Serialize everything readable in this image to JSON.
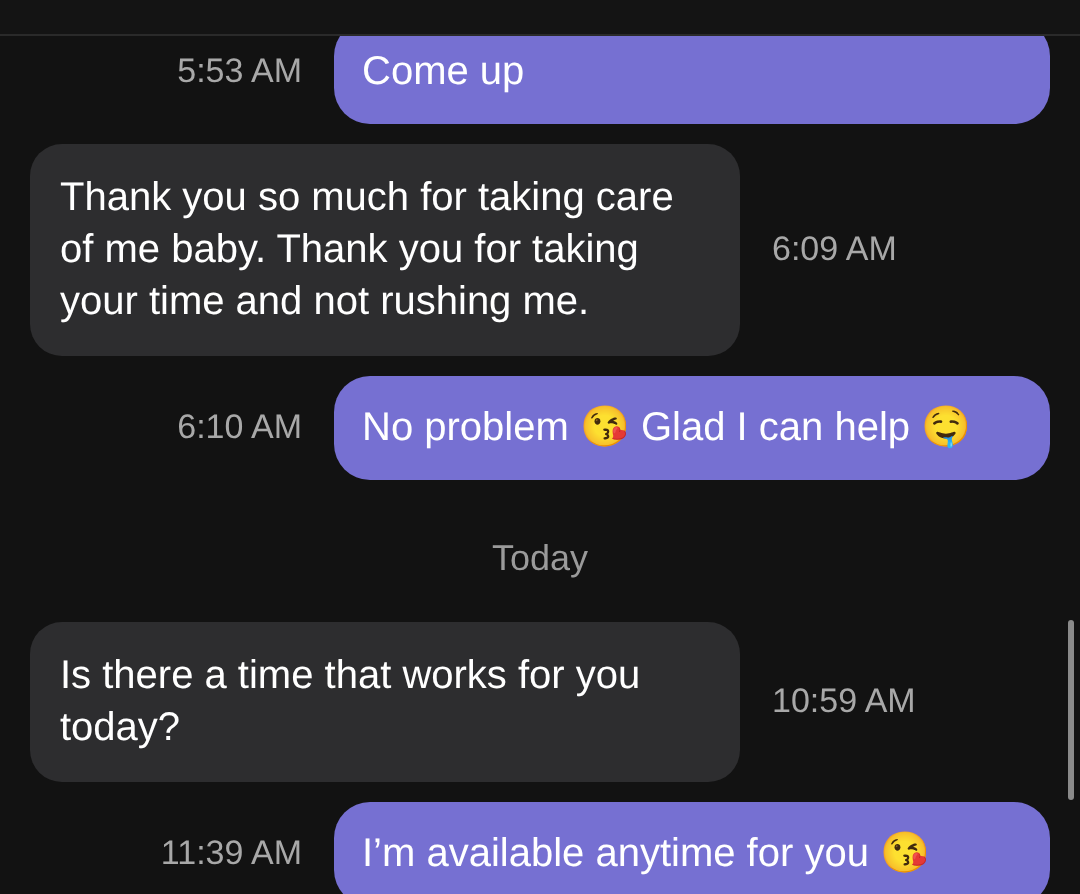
{
  "messages": [
    {
      "kind": "outgoing",
      "text": "Come up",
      "time": "5:53 AM"
    },
    {
      "kind": "incoming",
      "text": "Thank you so much for taking care of me baby. Thank you for taking your time and not rushing me.",
      "time": "6:09 AM"
    },
    {
      "kind": "outgoing",
      "text": "No problem 😘 Glad I can help 🤤",
      "time": "6:10 AM"
    },
    {
      "kind": "date",
      "text": "Today"
    },
    {
      "kind": "incoming",
      "text": "Is there a time that works for you today?",
      "time": "10:59 AM"
    },
    {
      "kind": "outgoing",
      "text": "I’m available anytime for you 😘",
      "time": "11:39 AM"
    }
  ]
}
